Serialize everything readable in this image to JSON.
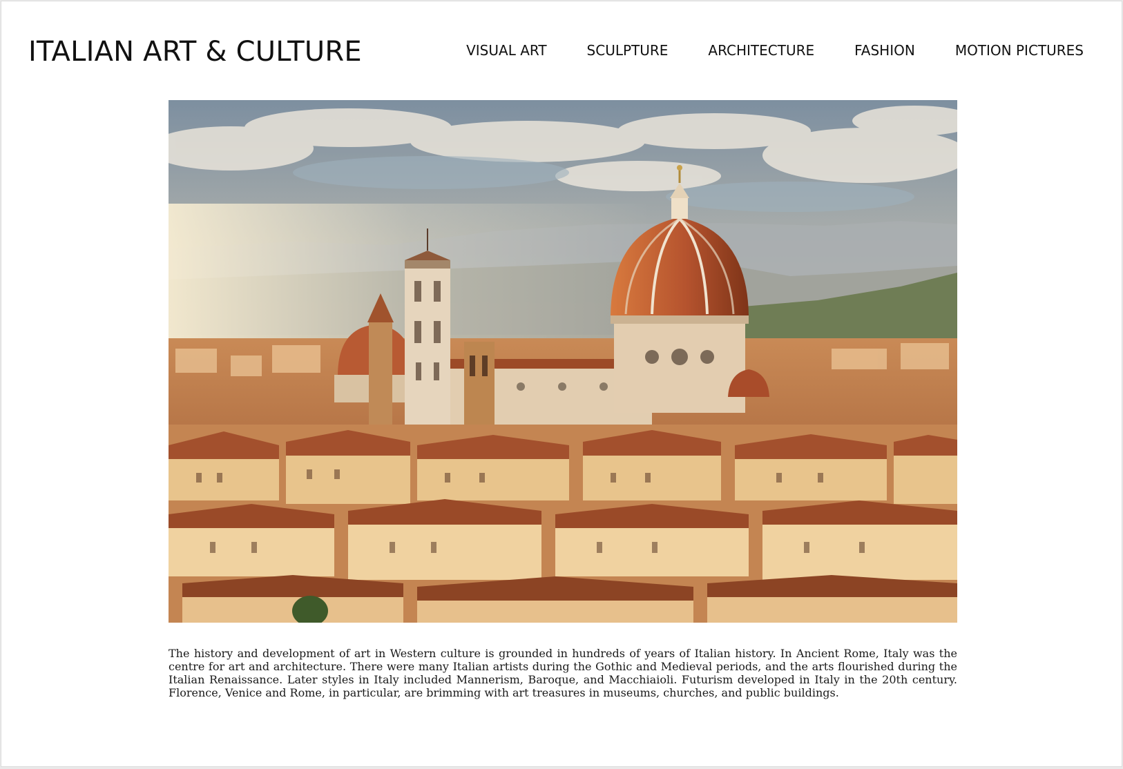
{
  "header": {
    "site_title": "ITALIAN ART & CULTURE"
  },
  "nav": {
    "items": [
      {
        "label": "VISUAL ART"
      },
      {
        "label": "SCULPTURE"
      },
      {
        "label": "ARCHITECTURE"
      },
      {
        "label": "FASHION"
      },
      {
        "label": "MOTION PICTURES"
      }
    ]
  },
  "hero": {
    "subject": "Florence skyline with the cathedral dome and bell tower"
  },
  "intro": {
    "text": "The history and development of art in Western culture is grounded in hundreds of years of Italian history. In Ancient Rome, Italy was the centre for art and architecture. There were many Italian artists during the Gothic and Medieval periods, and the arts flourished during the Italian Renaissance. Later styles in Italy included Mannerism, Baroque, and Macchiaioli. Futurism developed in Italy in the 20th century. Florence, Venice and Rome, in particular, are brimming with art treasures in museums, churches, and public buildings."
  },
  "colors": {
    "background": "#ffffff",
    "text": "#111111",
    "terracotta": "#b5532e"
  }
}
